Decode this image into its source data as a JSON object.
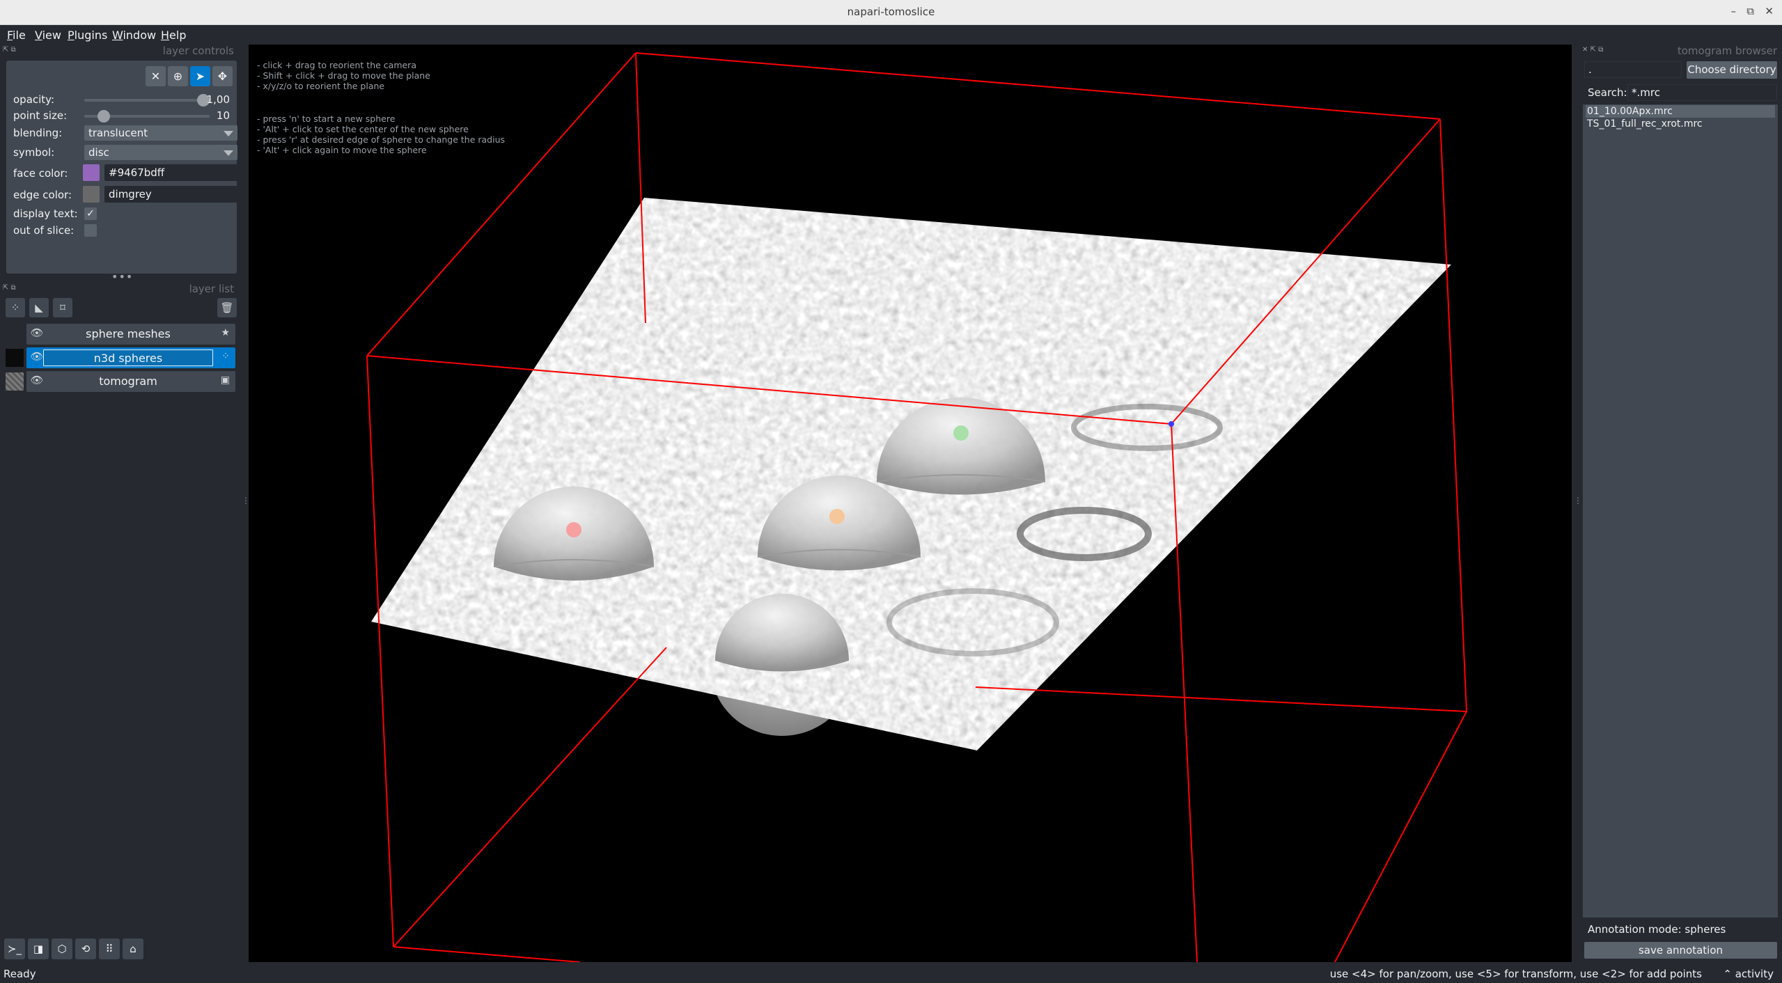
{
  "window": {
    "title": "napari-tomoslice"
  },
  "menu": [
    "File",
    "View",
    "Plugins",
    "Window",
    "Help"
  ],
  "layer_controls": {
    "header": "layer controls",
    "tools": {
      "delete": "✕",
      "add": "⊕",
      "select": "➤",
      "pan": "✥"
    },
    "opacity": {
      "label": "opacity:",
      "value": "1,00",
      "fraction": 1.0
    },
    "point_size": {
      "label": "point size:",
      "value": "10",
      "fraction": 0.12
    },
    "blending": {
      "label": "blending:",
      "value": "translucent"
    },
    "symbol": {
      "label": "symbol:",
      "value": "disc"
    },
    "face_color": {
      "label": "face color:",
      "value": "#9467bdff",
      "swatch": "#9467bd"
    },
    "edge_color": {
      "label": "edge color:",
      "value": "dimgrey",
      "swatch": "#696969"
    },
    "display_text": {
      "label": "display text:",
      "checked": true,
      "mark": "✓"
    },
    "out_of_slice": {
      "label": "out of slice:",
      "checked": false
    },
    "splitter": "•••"
  },
  "layer_list": {
    "header": "layer list",
    "tools": [
      "new-points",
      "new-shapes",
      "new-labels",
      "delete"
    ],
    "layers": [
      {
        "name": "sphere meshes",
        "visible": true,
        "type_icon": "★",
        "selected": false,
        "eye": "👁"
      },
      {
        "name": "n3d spheres",
        "visible": true,
        "type_icon": "⁘",
        "selected": true,
        "eye": "👁"
      },
      {
        "name": "tomogram",
        "visible": true,
        "type_icon": "▣",
        "selected": false,
        "eye": "👁"
      }
    ]
  },
  "viewer_buttons": [
    "console",
    "ndisplay-toggle",
    "roll-axes",
    "transpose",
    "grid",
    "home"
  ],
  "viewer_buttons_glyphs": [
    "≻_",
    "◨",
    "⬡",
    "⟲",
    "⠿",
    "⌂"
  ],
  "viewer": {
    "help_lines_1": [
      "- click + drag to reorient the camera",
      "- Shift + click + drag to move the plane",
      "- x/y/z/o to reorient the plane"
    ],
    "help_lines_2": [
      "- press 'n' to start a new sphere",
      "- 'Alt' + click to set the center of the new sphere",
      "- press 'r' at desired edge of sphere to change the radius",
      "- 'Alt' + click again to move the sphere"
    ],
    "bbox_color": "#ff0000",
    "sphere_center_colors": [
      "#f7a0a0",
      "#f5c79a",
      "#a8e0a8"
    ]
  },
  "tomogram_browser": {
    "header": "tomogram browser",
    "directory": ".",
    "choose_button": "Choose directory",
    "search_label": "Search:",
    "search_value": "*.mrc",
    "files": [
      {
        "name": "01_10.00Apx.mrc",
        "selected": true
      },
      {
        "name": "TS_01_full_rec_xrot.mrc",
        "selected": false
      }
    ],
    "annotation_mode": "Annotation mode: spheres",
    "save_button": "save annotation"
  },
  "status": {
    "left": "Ready",
    "help": "use <4> for pan/zoom, use <5> for transform, use <2> for add points",
    "activity": "⌃ activity"
  }
}
